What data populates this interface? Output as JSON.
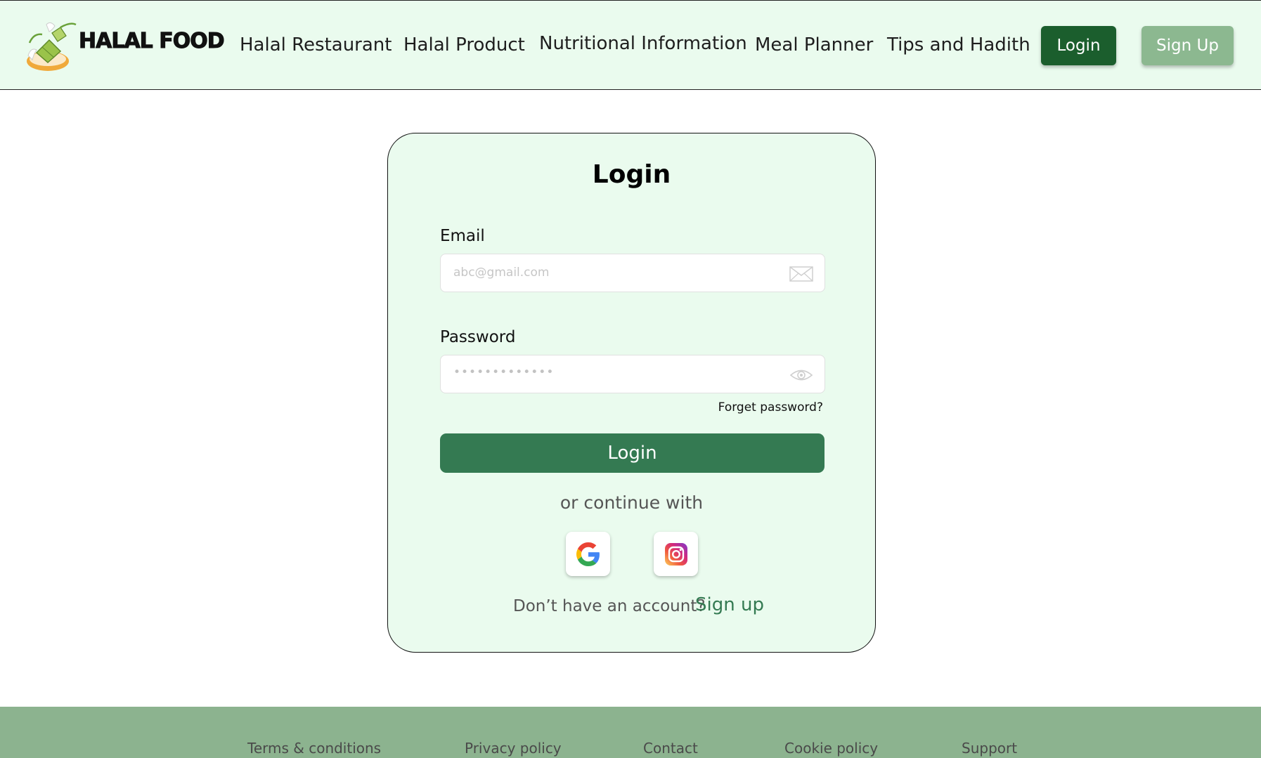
{
  "header": {
    "brand": "HALAL FOOD",
    "nav": {
      "restaurant": "Halal Restaurant",
      "product": "Halal Product",
      "nutrition": "Nutritional Information",
      "meal_planner": "Meal Planner",
      "tips": "Tips and Hadith"
    },
    "login_label": "Login",
    "signup_label": "Sign Up"
  },
  "login_form": {
    "title": "Login",
    "email_label": "Email",
    "email_placeholder": "abc@gmail.com",
    "password_label": "Password",
    "password_masked": "•••••••••••••",
    "forgot_label": "Forget password?",
    "submit_label": "Login",
    "continue_text": "or continue with",
    "no_account_text": "Don’t have an account?",
    "signup_link": "Sign up"
  },
  "footer": {
    "terms": "Terms & conditions",
    "privacy": "Privacy policy",
    "contact": "Contact",
    "cookie": "Cookie policy",
    "support": "Support"
  },
  "colors": {
    "header_bg": "#eafbee",
    "primary": "#1b5e2d",
    "button_green": "#347a52",
    "signup_green": "#8cb890",
    "footer_bg": "#8cb38f"
  }
}
